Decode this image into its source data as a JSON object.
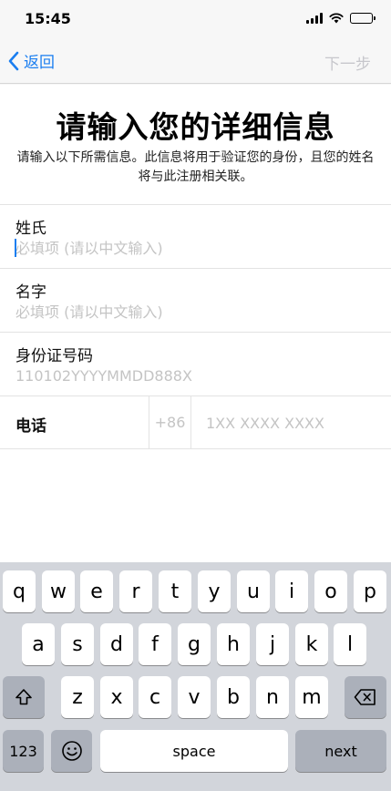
{
  "status": {
    "time": "15:45"
  },
  "nav": {
    "back": "返回",
    "next": "下一步"
  },
  "page": {
    "title": "请输入您的详细信息",
    "description": "请输入以下所需信息。此信息将用于验证您的身份，且您的姓名将与此注册相关联。"
  },
  "form": {
    "surname": {
      "label": "姓氏",
      "placeholder": "必填项 (请以中文输入)"
    },
    "given_name": {
      "label": "名字",
      "placeholder": "必填项 (请以中文输入)"
    },
    "id_number": {
      "label": "身份证号码",
      "placeholder": "110102YYYYMMDD888X"
    },
    "phone": {
      "label": "电话",
      "prefix": "+86",
      "placeholder": "1XX XXXX XXXX"
    }
  },
  "keyboard": {
    "row1": [
      "q",
      "w",
      "e",
      "r",
      "t",
      "y",
      "u",
      "i",
      "o",
      "p"
    ],
    "row2": [
      "a",
      "s",
      "d",
      "f",
      "g",
      "h",
      "j",
      "k",
      "l"
    ],
    "row3": [
      "z",
      "x",
      "c",
      "v",
      "b",
      "n",
      "m"
    ],
    "numbers": "123",
    "space": "space",
    "next": "next"
  }
}
